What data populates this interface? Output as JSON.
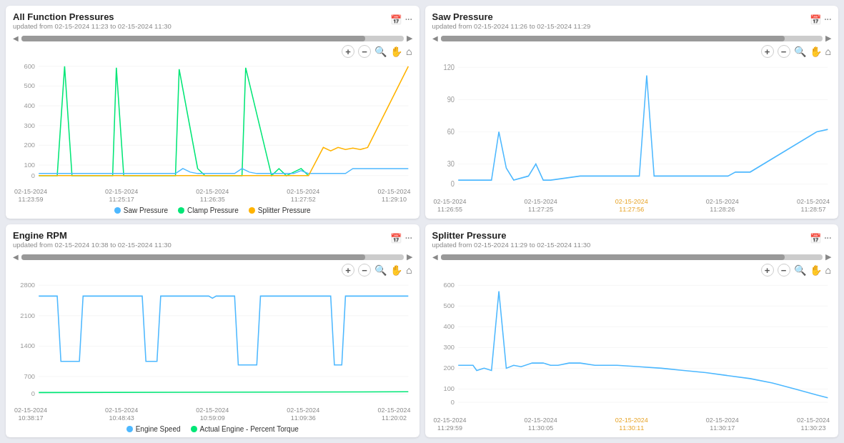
{
  "panels": [
    {
      "id": "all-function-pressures",
      "title": "All Function Pressures",
      "subtitle": "updated from 02-15-2024 11:23 to 02-15-2024 11:30",
      "xLabels": [
        {
          "line1": "02-15-2024",
          "line2": "11:23:59"
        },
        {
          "line1": "02-15-2024",
          "line2": "11:25:17"
        },
        {
          "line1": "02-15-2024",
          "line2": "11:26:35"
        },
        {
          "line1": "02-15-2024",
          "line2": "11:27:52"
        },
        {
          "line1": "02-15-2024",
          "line2": "11:29:10"
        }
      ],
      "yLabels": [
        "600",
        "500",
        "400",
        "300",
        "200",
        "100",
        "0"
      ],
      "legend": [
        {
          "label": "Saw Pressure",
          "color": "#4db8ff"
        },
        {
          "label": "Clamp Pressure",
          "color": "#00e676"
        },
        {
          "label": "Splitter Pressure",
          "color": "#ffb300"
        }
      ]
    },
    {
      "id": "saw-pressure",
      "title": "Saw Pressure",
      "subtitle": "updated from 02-15-2024 11:26 to 02-15-2024 11:29",
      "xLabels": [
        {
          "line1": "02-15-2024",
          "line2": "11:26:55"
        },
        {
          "line1": "02-15-2024",
          "line2": "11:27:25"
        },
        {
          "line1": "02-15-2024",
          "line2": "11:27:56",
          "orange": true
        },
        {
          "line1": "02-15-2024",
          "line2": "11:28:26"
        },
        {
          "line1": "02-15-2024",
          "line2": "11:28:57"
        }
      ],
      "yLabels": [
        "120",
        "90",
        "60",
        "30",
        "0"
      ],
      "legend": []
    },
    {
      "id": "engine-rpm",
      "title": "Engine RPM",
      "subtitle": "updated from 02-15-2024 10:38 to 02-15-2024 11:30",
      "xLabels": [
        {
          "line1": "02-15-2024",
          "line2": "10:38:17"
        },
        {
          "line1": "02-15-2024",
          "line2": "10:48:43"
        },
        {
          "line1": "02-15-2024",
          "line2": "10:59:09"
        },
        {
          "line1": "02-15-2024",
          "line2": "11:09:36"
        },
        {
          "line1": "02-15-2024",
          "line2": "11:20:02"
        }
      ],
      "yLabels": [
        "2800",
        "2100",
        "1400",
        "700",
        "0"
      ],
      "legend": [
        {
          "label": "Engine Speed",
          "color": "#4db8ff"
        },
        {
          "label": "Actual Engine - Percent Torque",
          "color": "#00e676"
        }
      ]
    },
    {
      "id": "splitter-pressure",
      "title": "Splitter Pressure",
      "subtitle": "updated from 02-15-2024 11:29 to 02-15-2024 11:30",
      "xLabels": [
        {
          "line1": "02-15-2024",
          "line2": "11:29:59"
        },
        {
          "line1": "02-15-2024",
          "line2": "11:30:05"
        },
        {
          "line1": "02-15-2024",
          "line2": "11:30:11",
          "orange": true
        },
        {
          "line1": "02-15-2024",
          "line2": "11:30:17"
        },
        {
          "line1": "02-15-2024",
          "line2": "11:30:23"
        }
      ],
      "yLabels": [
        "600",
        "500",
        "400",
        "300",
        "200",
        "100",
        "0"
      ],
      "legend": []
    }
  ],
  "icons": {
    "calendar": "📅",
    "more": "···",
    "zoomIn": "+",
    "zoomOut": "−",
    "magnify": "🔍",
    "hand": "✋",
    "home": "⌂",
    "prevArrow": "◀",
    "playBtn": "▶"
  }
}
